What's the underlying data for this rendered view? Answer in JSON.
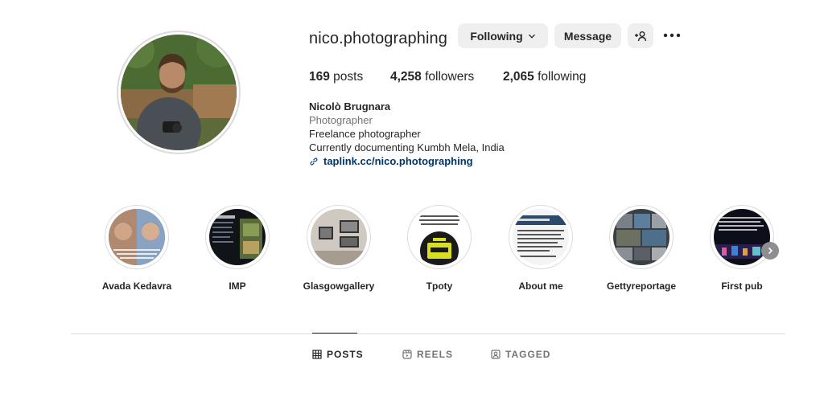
{
  "profile": {
    "username": "nico.photographing",
    "buttons": {
      "following": "Following",
      "message": "Message"
    },
    "stats": {
      "posts_count": "169",
      "posts_label": " posts",
      "followers_count": "4,258",
      "followers_label": " followers",
      "following_count": "2,065",
      "following_label": " following"
    },
    "bio": {
      "name": "Nicolò Brugnara",
      "category": "Photographer",
      "line1": "Freelance photographer",
      "line2": "Currently documenting Kumbh Mela, India",
      "link": "taplink.cc/nico.photographing"
    }
  },
  "highlights": [
    {
      "label": "Avada Kedavra"
    },
    {
      "label": "IMP"
    },
    {
      "label": "Glasgowgallery"
    },
    {
      "label": "Tpoty"
    },
    {
      "label": "About me"
    },
    {
      "label": "Gettyreportage"
    },
    {
      "label": "First pub"
    }
  ],
  "tabs": [
    {
      "label": "POSTS",
      "active": true
    },
    {
      "label": "REELS",
      "active": false
    },
    {
      "label": "TAGGED",
      "active": false
    }
  ],
  "icons": {
    "following_chevron": "chevron-down-icon",
    "suggest": "add-person-icon",
    "more": "more-options-icon",
    "link": "link-icon",
    "posts_tab": "grid-icon",
    "reels_tab": "reels-icon",
    "tagged_tab": "tagged-icon",
    "next": "chevron-right-icon"
  },
  "colors": {
    "button_bg": "#efefef",
    "link": "#00376b",
    "secondary_text": "#737373",
    "divider": "#dbdbdb"
  }
}
